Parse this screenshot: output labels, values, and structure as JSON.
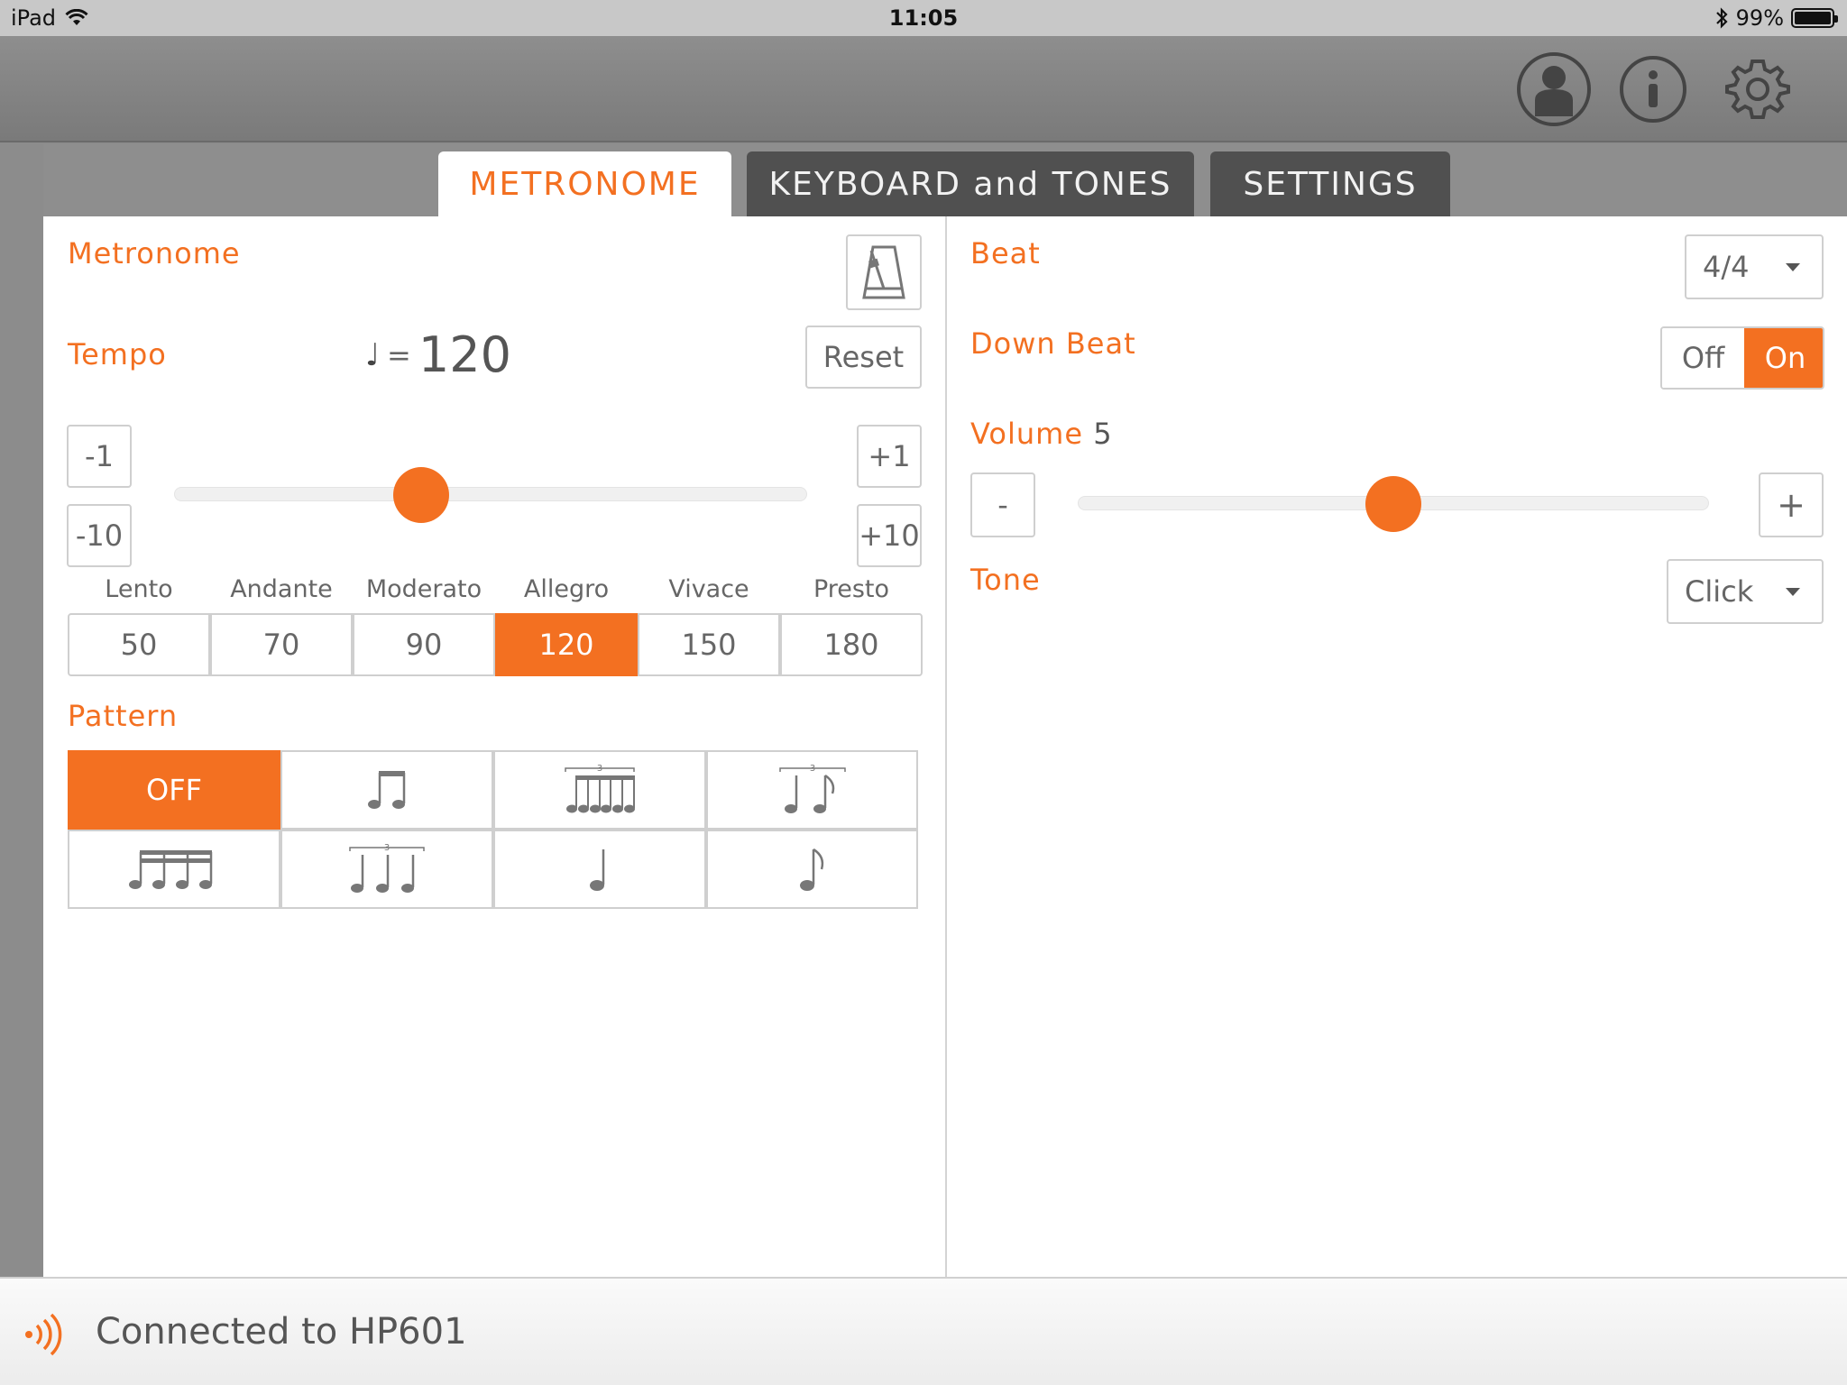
{
  "status_bar": {
    "device": "iPad",
    "time": "11:05",
    "battery": "99%"
  },
  "header": {
    "icons": [
      "account-icon",
      "info-icon",
      "gear-icon"
    ]
  },
  "tabs": [
    {
      "label": "METRONOME",
      "active": true
    },
    {
      "label": "KEYBOARD and TONES",
      "active": false
    },
    {
      "label": "SETTINGS",
      "active": false
    }
  ],
  "metronome": {
    "title": "Metronome",
    "tempo_label": "Tempo",
    "tempo_value": "120",
    "tempo_equals": "=",
    "reset_label": "Reset",
    "minus1_label": "-1",
    "minus10_label": "-10",
    "plus1_label": "+1",
    "plus10_label": "+10",
    "tempo_slider_fraction": 0.39,
    "presets": [
      {
        "name": "Lento",
        "value": "50"
      },
      {
        "name": "Andante",
        "value": "70"
      },
      {
        "name": "Moderato",
        "value": "90"
      },
      {
        "name": "Allegro",
        "value": "120",
        "selected": true
      },
      {
        "name": "Vivace",
        "value": "150"
      },
      {
        "name": "Presto",
        "value": "180"
      }
    ],
    "pattern_label": "Pattern",
    "pattern_off_label": "OFF",
    "patterns": [
      "off",
      "two-eighths",
      "eighth-triplet-x2",
      "triplet-quarter-eighth",
      "four-sixteenths",
      "quarter-triplet",
      "quarter",
      "eighth"
    ]
  },
  "beat": {
    "label": "Beat",
    "value": "4/4"
  },
  "down_beat": {
    "label": "Down Beat",
    "off_label": "Off",
    "on_label": "On",
    "state": "On"
  },
  "volume": {
    "label": "Volume",
    "value": "5",
    "minus_label": "-",
    "plus_label": "+",
    "slider_fraction": 0.5
  },
  "tone": {
    "label": "Tone",
    "value": "Click"
  },
  "footer": {
    "connection": "Connected to HP601"
  },
  "colors": {
    "accent": "#f37021",
    "tab_dark": "#505050",
    "header": "#8a8a8a"
  }
}
